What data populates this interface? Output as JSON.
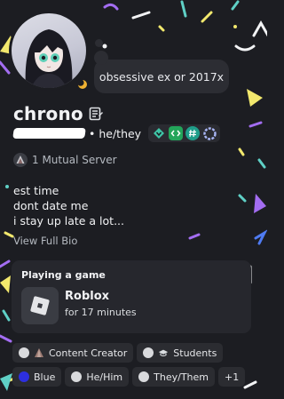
{
  "profile": {
    "display_name": "chrono",
    "pronouns": "• he/they",
    "custom_status": "obsessive ex or 2017x",
    "mutual_servers": "1 Mutual Server",
    "bio_lines": [
      "est time",
      "dont date me",
      "i stay up late a lot..."
    ],
    "view_bio_label": "View Full Bio"
  },
  "activity": {
    "heading": "Playing a game",
    "game_name": "Roblox",
    "duration": "for 17 minutes"
  },
  "roles": [
    {
      "label": "Content Creator",
      "dot_color": "#d9dadd"
    },
    {
      "label": "Students",
      "dot_color": "#d9dadd"
    },
    {
      "label": "Blue",
      "dot_color": "#2d2fe0"
    },
    {
      "label": "He/Him",
      "dot_color": "#d9dadd"
    },
    {
      "label": "They/Them",
      "dot_color": "#d9dadd"
    },
    {
      "label": "+1"
    }
  ],
  "colors": {
    "background": "#1c1d22",
    "card": "#26272d",
    "confetti": [
      "#f2e86d",
      "#5fd0c6",
      "#a36df2",
      "#f2f3f5",
      "#4f7bf2"
    ]
  }
}
